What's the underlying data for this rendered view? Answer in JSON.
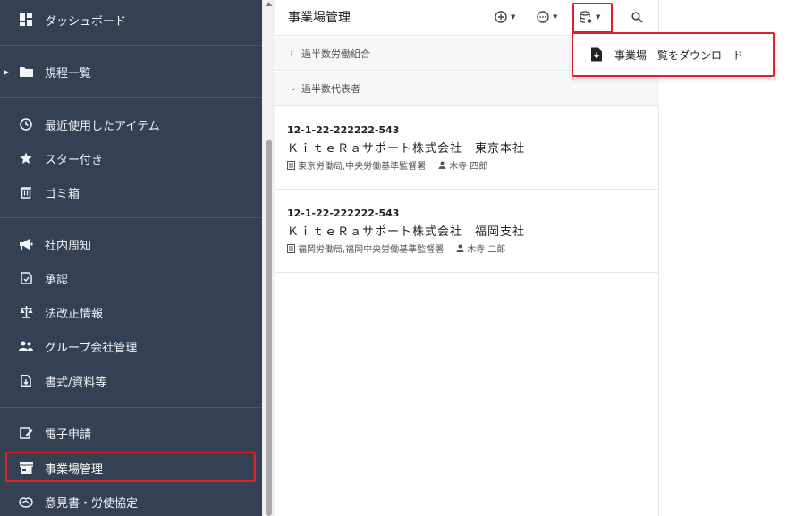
{
  "sidebar": {
    "items": [
      {
        "label": "ダッシュボード",
        "icon": "dashboard-icon"
      },
      {
        "label": "規程一覧",
        "icon": "folder-icon"
      },
      {
        "label": "最近使用したアイテム",
        "icon": "clock-icon"
      },
      {
        "label": "スター付き",
        "icon": "star-icon"
      },
      {
        "label": "ゴミ箱",
        "icon": "trash-icon"
      },
      {
        "label": "社内周知",
        "icon": "megaphone-icon"
      },
      {
        "label": "承認",
        "icon": "approval-icon"
      },
      {
        "label": "法改正情報",
        "icon": "scale-icon"
      },
      {
        "label": "グループ会社管理",
        "icon": "group-icon"
      },
      {
        "label": "書式/資料等",
        "icon": "document-download-icon"
      },
      {
        "label": "電子申請",
        "icon": "e-application-icon"
      },
      {
        "label": "事業場管理",
        "icon": "store-icon"
      },
      {
        "label": "意見書・労使協定",
        "icon": "handshake-icon"
      }
    ],
    "background": "#344152",
    "active_color": "#5ad1c1"
  },
  "panel": {
    "title": "事業場管理",
    "groups": [
      {
        "label": "過半数労働組合",
        "expanded": false
      },
      {
        "label": "過半数代表者",
        "expanded": true
      }
    ],
    "entries": [
      {
        "code": "12-1-22-222222-543",
        "name": "ＫｉｔｅＲａサポート株式会社　東京本社",
        "office": "東京労働局,中央労働基準監督署",
        "person": "木寺 四郎"
      },
      {
        "code": "12-1-22-222222-543",
        "name": "ＫｉｔｅＲａサポート株式会社　福岡支社",
        "office": "福岡労働局,福岡中央労働基準監督署",
        "person": "木寺 二郎"
      }
    ]
  },
  "dropdown": {
    "item_label": "事業場一覧をダウンロード",
    "icon": "file-download-icon"
  },
  "colors": {
    "highlight": "#e0202b",
    "accent": "#1a73e8"
  }
}
